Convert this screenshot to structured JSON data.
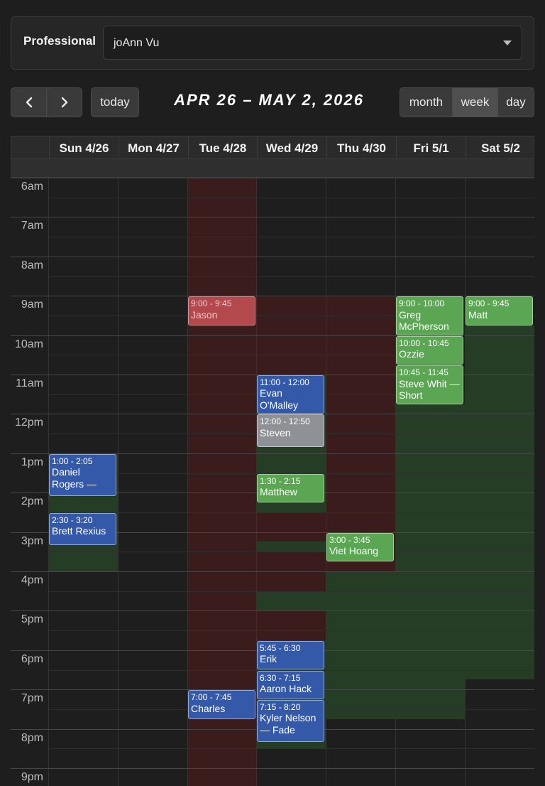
{
  "professional": {
    "label": "Professional",
    "selected": "joAnn Vu"
  },
  "toolbar": {
    "prev_icon": "chevron-left-icon",
    "next_icon": "chevron-right-icon",
    "today_label": "today",
    "range_title": "APR 26 – MAY 2, 2026",
    "views": [
      "month",
      "week",
      "day"
    ],
    "active_view": "week"
  },
  "calendar": {
    "days": [
      "Sun 4/26",
      "Mon 4/27",
      "Tue 4/28",
      "Wed 4/29",
      "Thu 4/30",
      "Fri 5/1",
      "Sat 5/2"
    ],
    "time_labels": [
      "6am",
      "7am",
      "8am",
      "9am",
      "10am",
      "11am",
      "12pm",
      "1pm",
      "2pm",
      "3pm",
      "4pm",
      "5pm",
      "6pm",
      "7pm",
      "8pm",
      "9pm"
    ],
    "events": [
      {
        "day": 0,
        "start": "13:00",
        "end": "14:05",
        "time": "1:00 - 2:05",
        "title": "Daniel Rogers —",
        "kind": "blue"
      },
      {
        "day": 0,
        "start": "14:30",
        "end": "15:20",
        "time": "2:30 - 3:20",
        "title": "Brett Rexius",
        "kind": "blue"
      },
      {
        "day": 2,
        "start": "09:00",
        "end": "09:45",
        "time": "9:00 - 9:45",
        "title": "Jason",
        "kind": "red"
      },
      {
        "day": 2,
        "start": "19:00",
        "end": "19:45",
        "time": "7:00 - 7:45",
        "title": "Charles",
        "kind": "blue"
      },
      {
        "day": 3,
        "start": "11:00",
        "end": "12:00",
        "time": "11:00 - 12:00",
        "title": "Evan O'Malley",
        "kind": "blue"
      },
      {
        "day": 3,
        "start": "12:00",
        "end": "12:50",
        "time": "12:00 - 12:50",
        "title": "Steven",
        "kind": "gray"
      },
      {
        "day": 3,
        "start": "13:30",
        "end": "14:15",
        "time": "1:30 - 2:15",
        "title": "Matthew",
        "kind": "green"
      },
      {
        "day": 3,
        "start": "17:45",
        "end": "18:30",
        "time": "5:45 - 6:30",
        "title": "Erik",
        "kind": "blue"
      },
      {
        "day": 3,
        "start": "18:30",
        "end": "19:15",
        "time": "6:30 - 7:15",
        "title": "Aaron Hack",
        "kind": "blue"
      },
      {
        "day": 3,
        "start": "19:15",
        "end": "20:20",
        "time": "7:15 - 8:20",
        "title": "Kyler Nelson — Fade",
        "kind": "blue"
      },
      {
        "day": 4,
        "start": "15:00",
        "end": "15:45",
        "time": "3:00 - 3:45",
        "title": "Viet Hoang",
        "kind": "green"
      },
      {
        "day": 5,
        "start": "09:00",
        "end": "10:00",
        "time": "9:00 - 10:00",
        "title": "Greg McPherson",
        "kind": "green"
      },
      {
        "day": 5,
        "start": "10:00",
        "end": "10:45",
        "time": "10:00 - 10:45",
        "title": "Ozzie",
        "kind": "green"
      },
      {
        "day": 5,
        "start": "10:45",
        "end": "11:45",
        "time": "10:45 - 11:45",
        "title": "Steve Whit — Short",
        "kind": "green"
      },
      {
        "day": 6,
        "start": "09:00",
        "end": "09:45",
        "time": "9:00 - 9:45",
        "title": "Matt",
        "kind": "green"
      }
    ],
    "availability": [
      {
        "day": 0,
        "start": "13:00",
        "end": "16:00",
        "kind": "green"
      },
      {
        "day": 2,
        "start": "06:00",
        "end": "21:30",
        "kind": "red"
      },
      {
        "day": 3,
        "start": "09:00",
        "end": "11:00",
        "kind": "red"
      },
      {
        "day": 3,
        "start": "11:00",
        "end": "14:30",
        "kind": "green"
      },
      {
        "day": 3,
        "start": "14:30",
        "end": "15:15",
        "kind": "red"
      },
      {
        "day": 3,
        "start": "15:15",
        "end": "15:30",
        "kind": "green"
      },
      {
        "day": 3,
        "start": "15:30",
        "end": "16:30",
        "kind": "red"
      },
      {
        "day": 3,
        "start": "16:30",
        "end": "17:00",
        "kind": "green"
      },
      {
        "day": 3,
        "start": "17:00",
        "end": "17:45",
        "kind": "red"
      },
      {
        "day": 3,
        "start": "17:45",
        "end": "20:30",
        "kind": "green"
      },
      {
        "day": 4,
        "start": "09:00",
        "end": "16:00",
        "kind": "red"
      },
      {
        "day": 4,
        "start": "16:00",
        "end": "19:45",
        "kind": "green"
      },
      {
        "day": 5,
        "start": "11:45",
        "end": "19:45",
        "kind": "green"
      },
      {
        "day": 6,
        "start": "09:45",
        "end": "18:45",
        "kind": "green"
      }
    ]
  }
}
